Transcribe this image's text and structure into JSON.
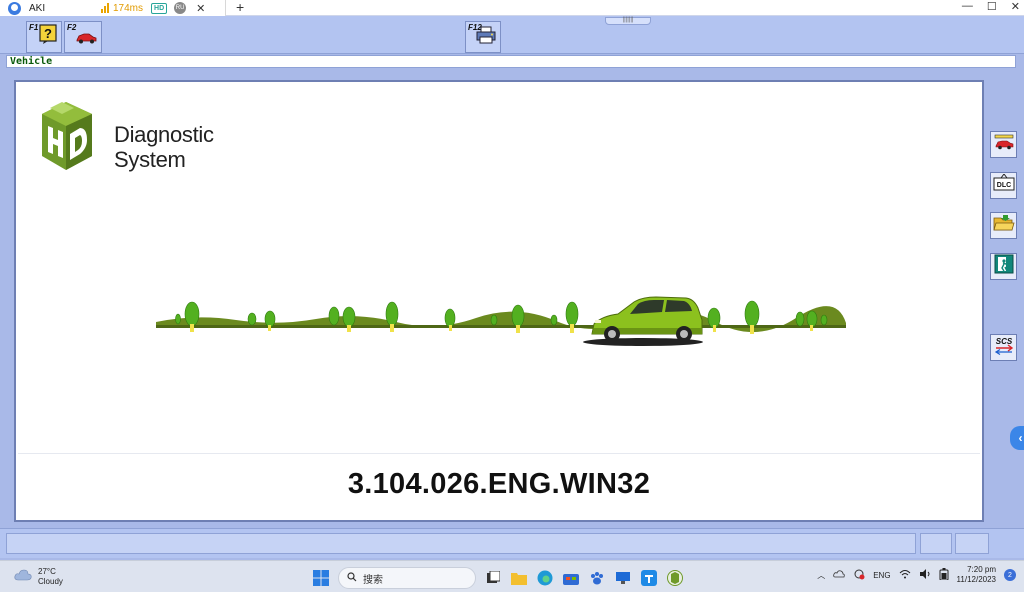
{
  "session_tab": {
    "title": "AKI",
    "latency": "174ms",
    "badge_hd": "HD",
    "badge_ru": "RU",
    "close": "✕",
    "new_tab": "+"
  },
  "window_controls": {
    "minimize": "—",
    "maximize": "☐",
    "close": "✕"
  },
  "toolbar": {
    "f1_label": "F1",
    "f2_label": "F2",
    "f12_label": "F12"
  },
  "vehicle_bar": {
    "label": "Vehicle"
  },
  "splash": {
    "logo_line1": "Diagnostic",
    "logo_line2": "System",
    "version": "3.104.026.ENG.WIN32"
  },
  "side_buttons": {
    "dlc_label": "DLC",
    "scs_label": "SCS"
  },
  "taskbar": {
    "temperature": "27°C",
    "weather": "Cloudy",
    "search_placeholder": "搜索",
    "language": "ENG",
    "time": "7:20 pm",
    "date": "11/12/2023",
    "notifications": "2"
  },
  "colors": {
    "app_bg": "#a9b9e8",
    "logo_green": "#6f9a2a",
    "car_green": "#8cc11e",
    "accent_blue": "#3b86e8"
  }
}
